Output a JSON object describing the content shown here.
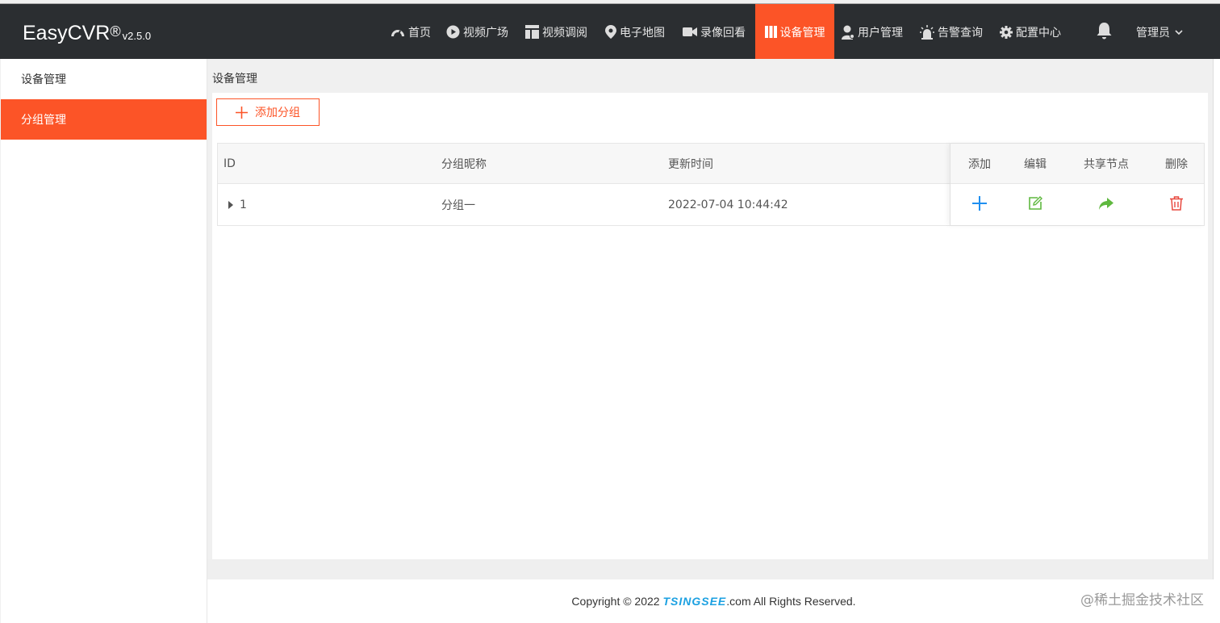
{
  "app": {
    "name": "EasyCVR",
    "reg": "®",
    "version": "v2.5.0"
  },
  "nav": [
    {
      "label": "首页",
      "icon": "dashboard-icon"
    },
    {
      "label": "视频广场",
      "icon": "play-circle-icon"
    },
    {
      "label": "视频调阅",
      "icon": "layout-icon"
    },
    {
      "label": "电子地图",
      "icon": "map-pin-icon"
    },
    {
      "label": "录像回看",
      "icon": "video-camera-icon"
    },
    {
      "label": "设备管理",
      "icon": "device-icon",
      "active": true
    },
    {
      "label": "用户管理",
      "icon": "user-icon"
    },
    {
      "label": "告警查询",
      "icon": "alarm-icon"
    },
    {
      "label": "配置中心",
      "icon": "gear-icon"
    }
  ],
  "user": {
    "label": "管理员"
  },
  "sidebar": {
    "items": [
      {
        "label": "设备管理",
        "active": false
      },
      {
        "label": "分组管理",
        "active": true
      }
    ]
  },
  "breadcrumb": "设备管理",
  "toolbar": {
    "add_group_label": "添加分组"
  },
  "table": {
    "headers": {
      "id": "ID",
      "name": "分组昵称",
      "updated": "更新时间",
      "add": "添加",
      "edit": "编辑",
      "share": "共享节点",
      "delete": "删除"
    },
    "rows": [
      {
        "id": "1",
        "name": "分组一",
        "updated": "2022-07-04 10:44:42"
      }
    ]
  },
  "footer": {
    "prefix": "Copyright © 2022 ",
    "brand": "TSINGSEE",
    "suffix": ".com All Rights Reserved."
  },
  "watermark": "@稀土掘金技术社区",
  "colors": {
    "accent": "#fc5427",
    "topbar": "#2b2e31",
    "add": "#1f8ff0",
    "edit": "#5fb83f",
    "share": "#5fb83f",
    "delete": "#e8483e"
  }
}
